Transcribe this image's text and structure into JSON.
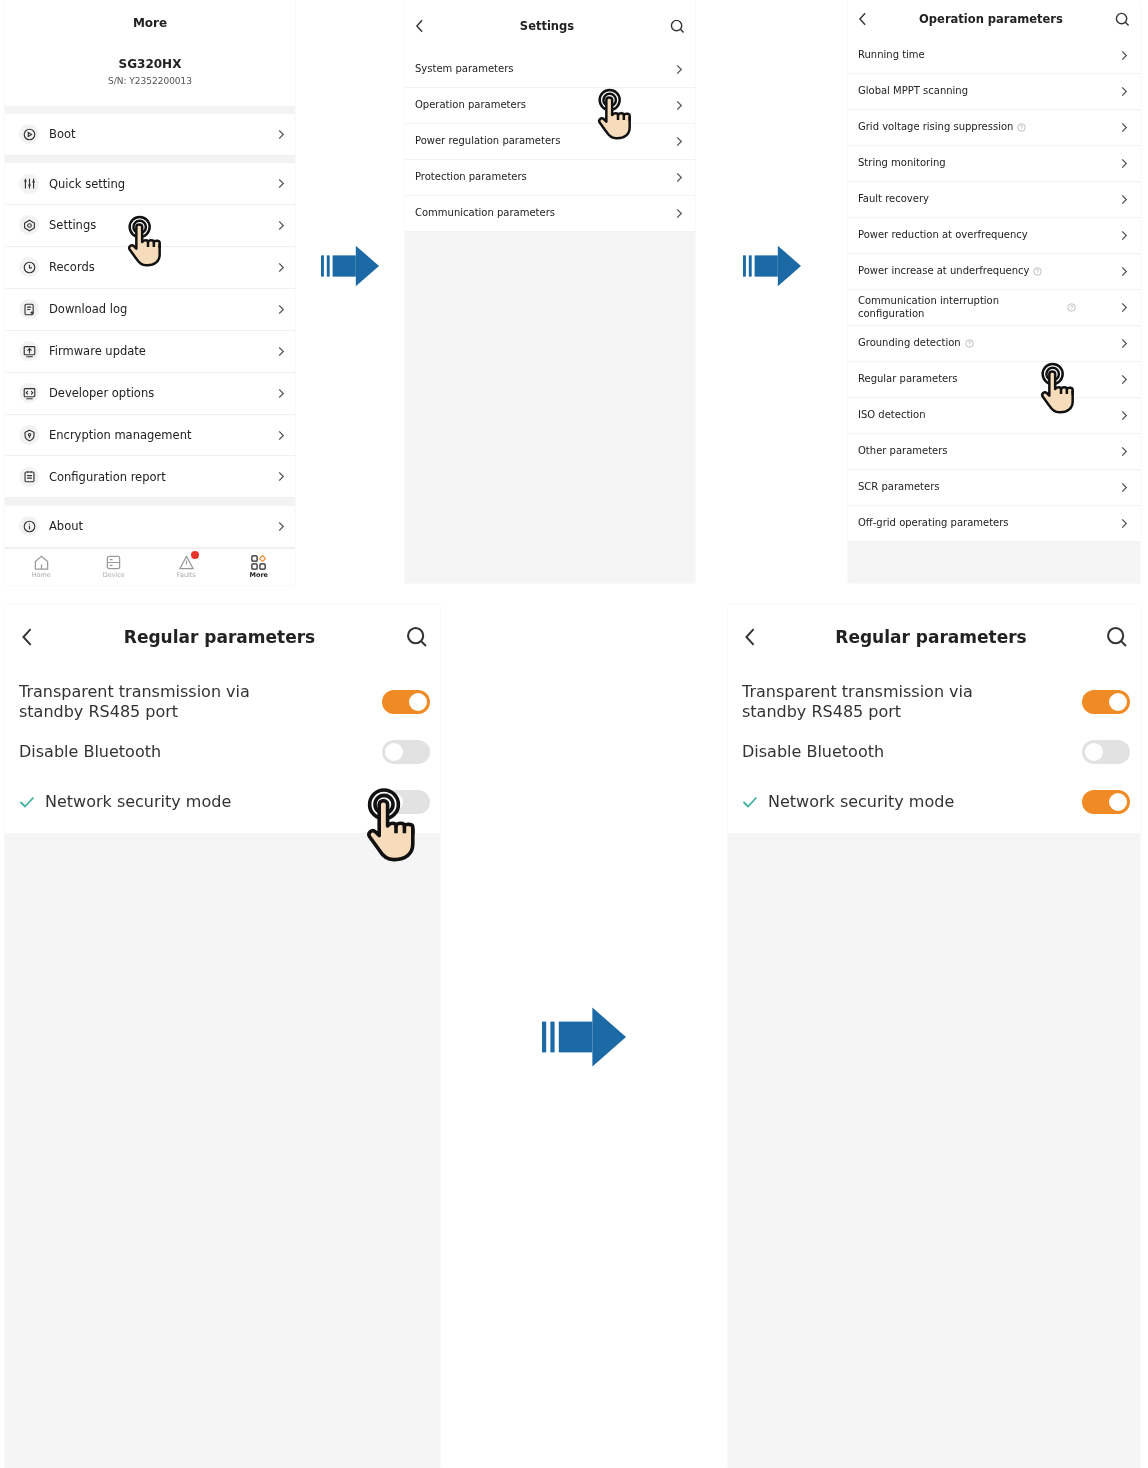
{
  "screens": [
    {
      "kind": "more",
      "title": "More",
      "model": "SG320HX",
      "serial": "S/N: Y2352200013",
      "groups": [
        [
          {
            "label": "Boot",
            "tapped": false
          }
        ],
        [
          {
            "label": "Quick setting",
            "tapped": false
          },
          {
            "label": "Settings",
            "tapped": true
          },
          {
            "label": "Records",
            "tapped": false
          },
          {
            "label": "Download log",
            "tapped": false
          },
          {
            "label": "Firmware update",
            "tapped": false
          },
          {
            "label": "Developer options",
            "tapped": false
          },
          {
            "label": "Encryption management",
            "tapped": false
          },
          {
            "label": "Configuration report",
            "tapped": false
          }
        ],
        [
          {
            "label": "About",
            "tapped": false
          }
        ]
      ],
      "tab_bar": [
        {
          "label": "Home",
          "selected": false,
          "badge": false
        },
        {
          "label": "Device",
          "selected": false,
          "badge": false
        },
        {
          "label": "Faults",
          "selected": false,
          "badge": true
        },
        {
          "label": "More",
          "selected": true,
          "badge": false
        }
      ]
    },
    {
      "kind": "list",
      "title": "Settings",
      "items": [
        {
          "label": "System parameters",
          "help": false,
          "tapped": false
        },
        {
          "label": "Operation parameters",
          "help": false,
          "tapped": true
        },
        {
          "label": "Power regulation parameters",
          "help": false,
          "tapped": false
        },
        {
          "label": "Protection parameters",
          "help": false,
          "tapped": false
        },
        {
          "label": "Communication parameters",
          "help": false,
          "tapped": false
        }
      ]
    },
    {
      "kind": "list",
      "title": "Operation parameters",
      "items": [
        {
          "label": "Running time",
          "help": false,
          "tapped": false
        },
        {
          "label": "Global MPPT scanning",
          "help": false,
          "tapped": false
        },
        {
          "label": "Grid voltage rising suppression",
          "help": true,
          "tapped": false
        },
        {
          "label": "String monitoring",
          "help": false,
          "tapped": false
        },
        {
          "label": "Fault recovery",
          "help": false,
          "tapped": false
        },
        {
          "label": "Power reduction at overfrequency",
          "help": false,
          "tapped": false
        },
        {
          "label": "Power increase at underfrequency",
          "help": true,
          "tapped": false
        },
        {
          "label": "Communication interruption configuration",
          "help": true,
          "tapped": false
        },
        {
          "label": "Grounding detection",
          "help": true,
          "tapped": false
        },
        {
          "label": "Regular parameters",
          "help": false,
          "tapped": true
        },
        {
          "label": "ISO detection",
          "help": false,
          "tapped": false
        },
        {
          "label": "Other parameters",
          "help": false,
          "tapped": false
        },
        {
          "label": "SCR parameters",
          "help": false,
          "tapped": false
        },
        {
          "label": "Off-grid operating parameters",
          "help": false,
          "tapped": false
        }
      ]
    },
    {
      "kind": "toggles",
      "title": "Regular parameters",
      "items": [
        {
          "label": "Transparent transmission via standby RS485 port",
          "marked": false,
          "on": true,
          "tapped": false
        },
        {
          "label": "Disable Bluetooth",
          "marked": false,
          "on": false,
          "tapped": false
        },
        {
          "label": "Network security mode",
          "marked": true,
          "on": false,
          "tapped": true
        }
      ]
    },
    {
      "kind": "toggles",
      "title": "Regular parameters",
      "items": [
        {
          "label": "Transparent transmission via standby RS485 port",
          "marked": false,
          "on": true,
          "tapped": false
        },
        {
          "label": "Disable Bluetooth",
          "marked": false,
          "on": false,
          "tapped": false
        },
        {
          "label": "Network security mode",
          "marked": true,
          "on": true,
          "tapped": false
        }
      ]
    }
  ]
}
